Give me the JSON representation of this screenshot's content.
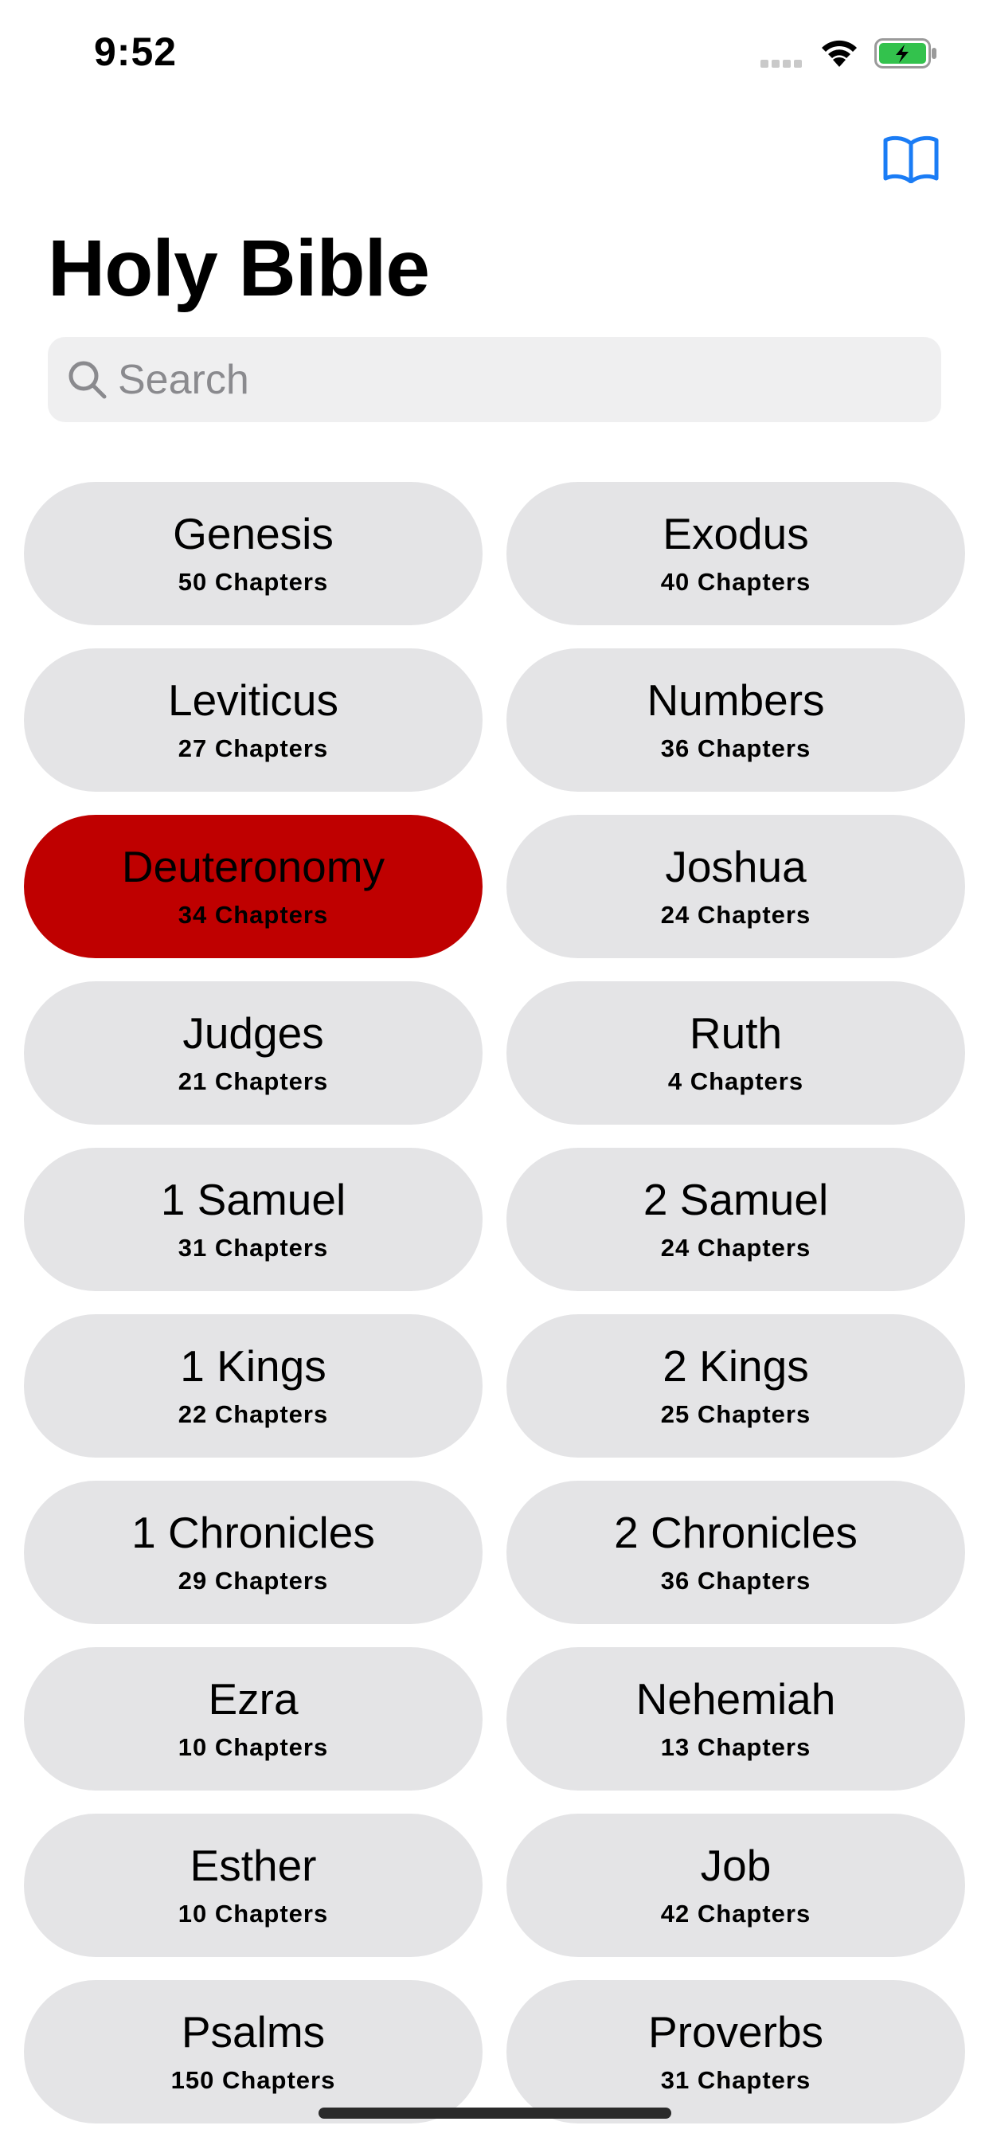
{
  "status_bar": {
    "time": "9:52"
  },
  "header": {
    "title": "Holy Bible"
  },
  "search": {
    "placeholder": "Search",
    "value": ""
  },
  "colors": {
    "accent": "#1a7cf5",
    "selected": "#bf0000",
    "card": "#e4e4e6",
    "search_bg": "#efeff0",
    "battery": "#33c24d"
  },
  "icons": {
    "nav_right": "book-icon",
    "search": "magnifier-icon"
  },
  "books": [
    {
      "name": "Genesis",
      "chapters": "50 Chapters",
      "selected": false
    },
    {
      "name": "Exodus",
      "chapters": "40 Chapters",
      "selected": false
    },
    {
      "name": "Leviticus",
      "chapters": "27 Chapters",
      "selected": false
    },
    {
      "name": "Numbers",
      "chapters": "36 Chapters",
      "selected": false
    },
    {
      "name": "Deuteronomy",
      "chapters": "34 Chapters",
      "selected": true
    },
    {
      "name": "Joshua",
      "chapters": "24 Chapters",
      "selected": false
    },
    {
      "name": "Judges",
      "chapters": "21 Chapters",
      "selected": false
    },
    {
      "name": "Ruth",
      "chapters": "4 Chapters",
      "selected": false
    },
    {
      "name": "1 Samuel",
      "chapters": "31 Chapters",
      "selected": false
    },
    {
      "name": "2 Samuel",
      "chapters": "24 Chapters",
      "selected": false
    },
    {
      "name": "1 Kings",
      "chapters": "22 Chapters",
      "selected": false
    },
    {
      "name": "2 Kings",
      "chapters": "25 Chapters",
      "selected": false
    },
    {
      "name": "1 Chronicles",
      "chapters": "29 Chapters",
      "selected": false
    },
    {
      "name": "2 Chronicles",
      "chapters": "36 Chapters",
      "selected": false
    },
    {
      "name": "Ezra",
      "chapters": "10 Chapters",
      "selected": false
    },
    {
      "name": "Nehemiah",
      "chapters": "13 Chapters",
      "selected": false
    },
    {
      "name": "Esther",
      "chapters": "10 Chapters",
      "selected": false
    },
    {
      "name": "Job",
      "chapters": "42 Chapters",
      "selected": false
    },
    {
      "name": "Psalms",
      "chapters": "150 Chapters",
      "selected": false
    },
    {
      "name": "Proverbs",
      "chapters": "31 Chapters",
      "selected": false
    }
  ]
}
